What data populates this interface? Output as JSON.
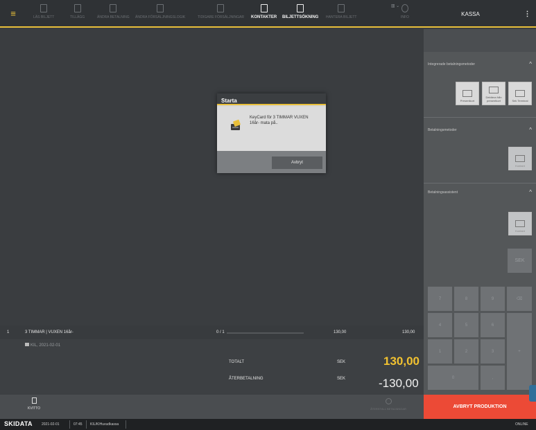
{
  "topbar": {
    "nav": [
      {
        "label": "LÄS BILJETT",
        "icon": "ticket-read-icon",
        "active": false
      },
      {
        "label": "TILLÄGG",
        "icon": "add-icon",
        "active": false
      },
      {
        "label": "ÄNDRA BETALNING",
        "icon": "edit-payment-icon",
        "active": false
      },
      {
        "label": "ÄNDRA FÖRSÄLJNINGSLOGIK",
        "icon": "logic-icon",
        "active": false
      },
      {
        "label": "TIDIGARE FÖRSÄLJNINGAR",
        "icon": "history-icon",
        "active": false
      },
      {
        "label": "KONTAKTER",
        "icon": "contacts-icon",
        "active": true
      },
      {
        "label": "BILJETTSÖKNING",
        "icon": "ticket-search-icon",
        "active": true
      },
      {
        "label": "HANTERA BILJETT",
        "icon": "hand-icon",
        "active": false
      },
      {
        "label": "INFO",
        "icon": "info-icon",
        "active": false
      }
    ],
    "kassa": "KASSA",
    "more": "⋮",
    "view_toggle": "▥ ⌄"
  },
  "modal": {
    "title": "Starta",
    "message": "KeyCard för 3 TIMMAR VUXEN 16år- mata på..",
    "abort_label": "Avbryt"
  },
  "right_panel": {
    "integrated": {
      "title": "Integrerade betalningsmetoder",
      "cards": [
        "Presentkort",
        "Debitera från presentkort",
        "Sek Terminal"
      ]
    },
    "methods": {
      "title": "Betalningsmetoder",
      "cards": [
        "Kontant"
      ]
    },
    "assistant": {
      "title": "Betalningsassistent",
      "cards": [
        "Kontant"
      ],
      "sek": "SEK"
    },
    "keypad": [
      "7",
      "8",
      "9",
      "⌫",
      "4",
      "5",
      "6",
      "1",
      "2",
      "3",
      "+",
      "0",
      ","
    ]
  },
  "order": {
    "index": "1",
    "name": "3 TIMMAR | VUXEN 16år-",
    "sub": "KIL, 2021-02-01",
    "progress": "0 / 1",
    "unit_price": "130,00",
    "line_total": "130,00",
    "total_label": "TOTALT",
    "total_currency": "SEK",
    "total_value": "130,00",
    "refund_label": "ÅTERBETALNING",
    "refund_currency": "SEK",
    "refund_value": "-130,00"
  },
  "footer": {
    "kvitto": "KVITTO",
    "reset": "ÅTERSTÄLL BETALNINGAR",
    "abort_production": "AVBRYT PRODUKTION"
  },
  "statusbar": {
    "logo": "SKIDATA",
    "date": "2021-02-01",
    "time": "07:45",
    "location": "KIL/KIHuvudkassa",
    "status": "ONLINE"
  },
  "colors": {
    "accent": "#e9c03a",
    "danger": "#ec4a36",
    "total": "#f2c230"
  }
}
